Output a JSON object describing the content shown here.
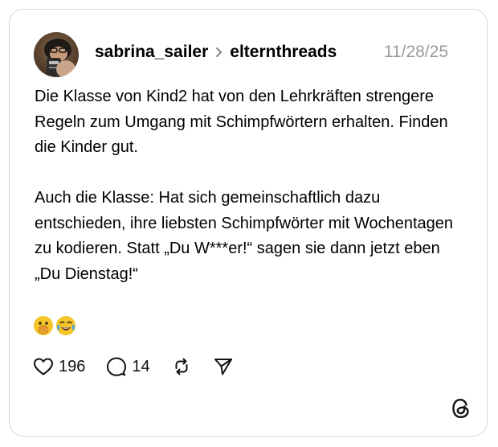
{
  "post": {
    "author": "sabrina_sailer",
    "channel": "elternthreads",
    "date": "11/28/25",
    "paragraphs": [
      "Die Klasse von Kind2 hat von den Lehrkräften strengere Regeln zum Umgang mit Schimpfwörtern erhalten. Finden die Kinder gut.",
      "Auch die Klasse: Hat sich gemeinschaftlich dazu entschieden, ihre liebsten Schimpfwörter mit Wochentagen zu kodieren. Statt „Du W***er!“ sagen sie dann jetzt eben „Du Dienstag!“"
    ],
    "emojis": [
      "face-with-open-eyes-and-hand-over-mouth",
      "face-with-tears-of-joy"
    ]
  },
  "actions": {
    "like_count": "196",
    "reply_count": "14"
  },
  "icons": {
    "like": "heart-icon",
    "reply": "reply-bubble-icon",
    "repost": "repost-icon",
    "share": "send-icon",
    "brand": "threads-logo-icon"
  },
  "colors": {
    "border": "#d6d6d6",
    "date": "#999999",
    "emoji": "#f5c52a"
  }
}
